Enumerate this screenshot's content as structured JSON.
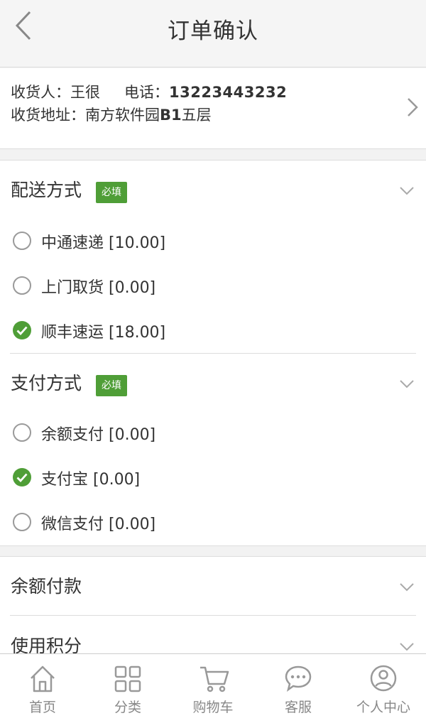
{
  "header": {
    "title": "订单确认"
  },
  "address": {
    "receiver_label": "收货人：",
    "receiver_name": "王很",
    "phone_label": "电话：",
    "phone_value": "13223443232",
    "address_label": "收货地址：",
    "address_text": "南方软件园",
    "address_bold": "B1",
    "address_tail": "五层"
  },
  "shipping": {
    "title": "配送方式",
    "required_badge": "必填",
    "options": [
      {
        "label": "中通速递 [10.00]",
        "selected": false
      },
      {
        "label": "上门取货 [0.00]",
        "selected": false
      },
      {
        "label": "顺丰速运 [18.00]",
        "selected": true
      }
    ]
  },
  "payment": {
    "title": "支付方式",
    "required_badge": "必填",
    "options": [
      {
        "label": "余额支付 [0.00]",
        "selected": false
      },
      {
        "label": "支付宝 [0.00]",
        "selected": true
      },
      {
        "label": "微信支付 [0.00]",
        "selected": false
      }
    ]
  },
  "balance": {
    "title": "余额付款"
  },
  "points": {
    "title": "使用积分"
  },
  "tabbar": {
    "items": [
      {
        "label": "首页",
        "icon": "home-icon"
      },
      {
        "label": "分类",
        "icon": "grid-icon"
      },
      {
        "label": "购物车",
        "icon": "cart-icon"
      },
      {
        "label": "客服",
        "icon": "chat-icon"
      },
      {
        "label": "个人中心",
        "icon": "user-icon"
      }
    ]
  },
  "colors": {
    "accent": "#4f9e37",
    "icon_gray": "#999999",
    "text": "#333333"
  }
}
